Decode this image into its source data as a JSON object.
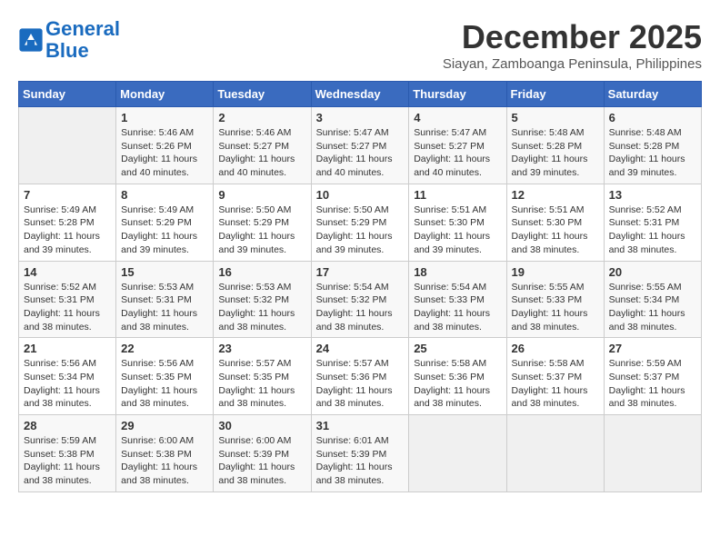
{
  "logo": {
    "line1": "General",
    "line2": "Blue"
  },
  "title": "December 2025",
  "subtitle": "Siayan, Zamboanga Peninsula, Philippines",
  "days_header": [
    "Sunday",
    "Monday",
    "Tuesday",
    "Wednesday",
    "Thursday",
    "Friday",
    "Saturday"
  ],
  "weeks": [
    [
      {
        "day": "",
        "info": ""
      },
      {
        "day": "1",
        "info": "Sunrise: 5:46 AM\nSunset: 5:26 PM\nDaylight: 11 hours\nand 40 minutes."
      },
      {
        "day": "2",
        "info": "Sunrise: 5:46 AM\nSunset: 5:27 PM\nDaylight: 11 hours\nand 40 minutes."
      },
      {
        "day": "3",
        "info": "Sunrise: 5:47 AM\nSunset: 5:27 PM\nDaylight: 11 hours\nand 40 minutes."
      },
      {
        "day": "4",
        "info": "Sunrise: 5:47 AM\nSunset: 5:27 PM\nDaylight: 11 hours\nand 40 minutes."
      },
      {
        "day": "5",
        "info": "Sunrise: 5:48 AM\nSunset: 5:28 PM\nDaylight: 11 hours\nand 39 minutes."
      },
      {
        "day": "6",
        "info": "Sunrise: 5:48 AM\nSunset: 5:28 PM\nDaylight: 11 hours\nand 39 minutes."
      }
    ],
    [
      {
        "day": "7",
        "info": "Sunrise: 5:49 AM\nSunset: 5:28 PM\nDaylight: 11 hours\nand 39 minutes."
      },
      {
        "day": "8",
        "info": "Sunrise: 5:49 AM\nSunset: 5:29 PM\nDaylight: 11 hours\nand 39 minutes."
      },
      {
        "day": "9",
        "info": "Sunrise: 5:50 AM\nSunset: 5:29 PM\nDaylight: 11 hours\nand 39 minutes."
      },
      {
        "day": "10",
        "info": "Sunrise: 5:50 AM\nSunset: 5:29 PM\nDaylight: 11 hours\nand 39 minutes."
      },
      {
        "day": "11",
        "info": "Sunrise: 5:51 AM\nSunset: 5:30 PM\nDaylight: 11 hours\nand 39 minutes."
      },
      {
        "day": "12",
        "info": "Sunrise: 5:51 AM\nSunset: 5:30 PM\nDaylight: 11 hours\nand 38 minutes."
      },
      {
        "day": "13",
        "info": "Sunrise: 5:52 AM\nSunset: 5:31 PM\nDaylight: 11 hours\nand 38 minutes."
      }
    ],
    [
      {
        "day": "14",
        "info": "Sunrise: 5:52 AM\nSunset: 5:31 PM\nDaylight: 11 hours\nand 38 minutes."
      },
      {
        "day": "15",
        "info": "Sunrise: 5:53 AM\nSunset: 5:31 PM\nDaylight: 11 hours\nand 38 minutes."
      },
      {
        "day": "16",
        "info": "Sunrise: 5:53 AM\nSunset: 5:32 PM\nDaylight: 11 hours\nand 38 minutes."
      },
      {
        "day": "17",
        "info": "Sunrise: 5:54 AM\nSunset: 5:32 PM\nDaylight: 11 hours\nand 38 minutes."
      },
      {
        "day": "18",
        "info": "Sunrise: 5:54 AM\nSunset: 5:33 PM\nDaylight: 11 hours\nand 38 minutes."
      },
      {
        "day": "19",
        "info": "Sunrise: 5:55 AM\nSunset: 5:33 PM\nDaylight: 11 hours\nand 38 minutes."
      },
      {
        "day": "20",
        "info": "Sunrise: 5:55 AM\nSunset: 5:34 PM\nDaylight: 11 hours\nand 38 minutes."
      }
    ],
    [
      {
        "day": "21",
        "info": "Sunrise: 5:56 AM\nSunset: 5:34 PM\nDaylight: 11 hours\nand 38 minutes."
      },
      {
        "day": "22",
        "info": "Sunrise: 5:56 AM\nSunset: 5:35 PM\nDaylight: 11 hours\nand 38 minutes."
      },
      {
        "day": "23",
        "info": "Sunrise: 5:57 AM\nSunset: 5:35 PM\nDaylight: 11 hours\nand 38 minutes."
      },
      {
        "day": "24",
        "info": "Sunrise: 5:57 AM\nSunset: 5:36 PM\nDaylight: 11 hours\nand 38 minutes."
      },
      {
        "day": "25",
        "info": "Sunrise: 5:58 AM\nSunset: 5:36 PM\nDaylight: 11 hours\nand 38 minutes."
      },
      {
        "day": "26",
        "info": "Sunrise: 5:58 AM\nSunset: 5:37 PM\nDaylight: 11 hours\nand 38 minutes."
      },
      {
        "day": "27",
        "info": "Sunrise: 5:59 AM\nSunset: 5:37 PM\nDaylight: 11 hours\nand 38 minutes."
      }
    ],
    [
      {
        "day": "28",
        "info": "Sunrise: 5:59 AM\nSunset: 5:38 PM\nDaylight: 11 hours\nand 38 minutes."
      },
      {
        "day": "29",
        "info": "Sunrise: 6:00 AM\nSunset: 5:38 PM\nDaylight: 11 hours\nand 38 minutes."
      },
      {
        "day": "30",
        "info": "Sunrise: 6:00 AM\nSunset: 5:39 PM\nDaylight: 11 hours\nand 38 minutes."
      },
      {
        "day": "31",
        "info": "Sunrise: 6:01 AM\nSunset: 5:39 PM\nDaylight: 11 hours\nand 38 minutes."
      },
      {
        "day": "",
        "info": ""
      },
      {
        "day": "",
        "info": ""
      },
      {
        "day": "",
        "info": ""
      }
    ]
  ]
}
